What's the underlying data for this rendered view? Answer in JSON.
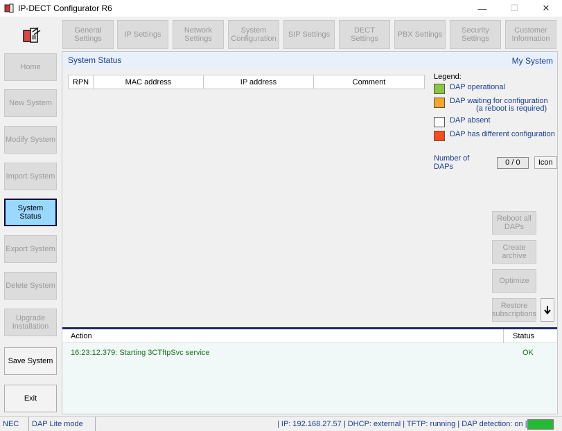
{
  "window": {
    "title": "IP-DECT Configurator R6",
    "minimize": "—",
    "maximize": "☐",
    "close": "✕"
  },
  "toolbar": {
    "items": [
      {
        "label": "General\nSettings"
      },
      {
        "label": "IP Settings"
      },
      {
        "label": "Network\nSettings"
      },
      {
        "label": "System\nConfiguration"
      },
      {
        "label": "SIP Settings"
      },
      {
        "label": "DECT\nSettings"
      },
      {
        "label": "PBX Settings"
      },
      {
        "label": "Security\nSettings"
      },
      {
        "label": "Customer\nInformation"
      }
    ]
  },
  "sidebar": {
    "items": [
      {
        "label": "Home"
      },
      {
        "label": "New System"
      },
      {
        "label": "Modify System"
      },
      {
        "label": "Import System"
      },
      {
        "label": "System\nStatus"
      },
      {
        "label": "Export System"
      },
      {
        "label": "Delete System"
      },
      {
        "label": "Upgrade\nInstallation"
      },
      {
        "label": "Save System"
      },
      {
        "label": "Exit"
      }
    ]
  },
  "panel": {
    "title": "System Status",
    "system_name": "My System",
    "columns": [
      "RPN",
      "MAC address",
      "IP address",
      "Comment"
    ]
  },
  "legend": {
    "title": "Legend:",
    "items": [
      {
        "label": "DAP operational",
        "color": "#8cc63f"
      },
      {
        "label": "DAP waiting for configuration",
        "sub": "(a reboot is required)",
        "color": "#f5a623"
      },
      {
        "label": "DAP absent",
        "color": "#ffffff"
      },
      {
        "label": "DAP has different configuration",
        "color": "#ff4a1a"
      }
    ]
  },
  "daps": {
    "label": "Number of DAPs",
    "value": "0 / 0",
    "icon_button": "Icon"
  },
  "actions": {
    "reboot": "Reboot all\nDAPs",
    "archive": "Create\narchive",
    "optimize": "Optimize",
    "restore": "Restore\nsubscriptions"
  },
  "log": {
    "header_action": "Action",
    "header_status": "Status",
    "rows": [
      {
        "action": "16:23:12.379: Starting 3CTftpSvc service",
        "status": "OK"
      }
    ]
  },
  "statusbar": {
    "vendor": "NEC",
    "mode": "DAP Lite mode",
    "info": "| IP: 192.168.27.57 | DHCP: external | TFTP: running | DAP detection: on |"
  }
}
